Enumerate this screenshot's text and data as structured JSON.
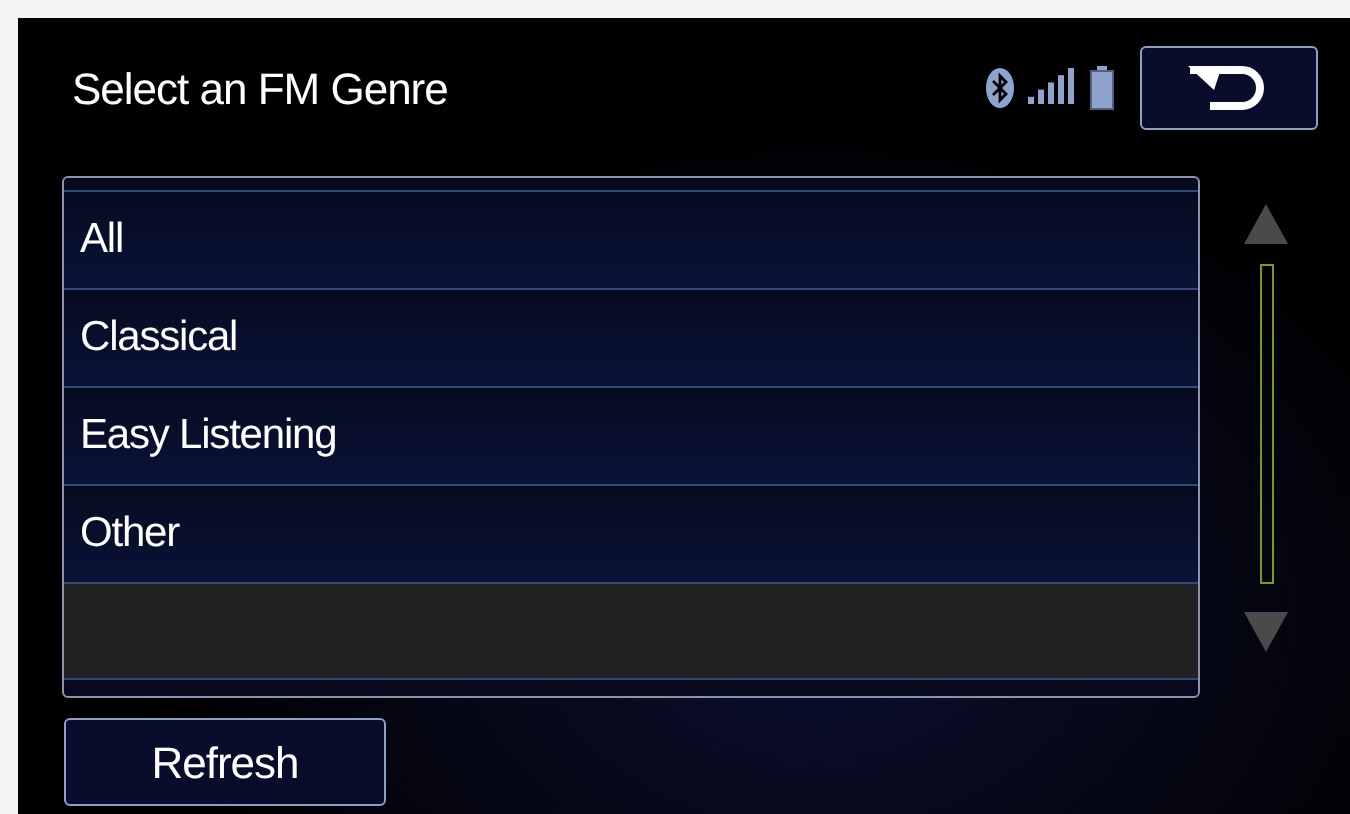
{
  "header": {
    "title": "Select an FM Genre"
  },
  "rows": [
    {
      "kind": "genre",
      "label": "All"
    },
    {
      "kind": "genre",
      "label": "Classical"
    },
    {
      "kind": "genre",
      "label": "Easy Listening"
    },
    {
      "kind": "genre",
      "label": "Other"
    },
    {
      "kind": "empty"
    }
  ],
  "buttons": [
    {
      "label": "Refresh"
    }
  ]
}
